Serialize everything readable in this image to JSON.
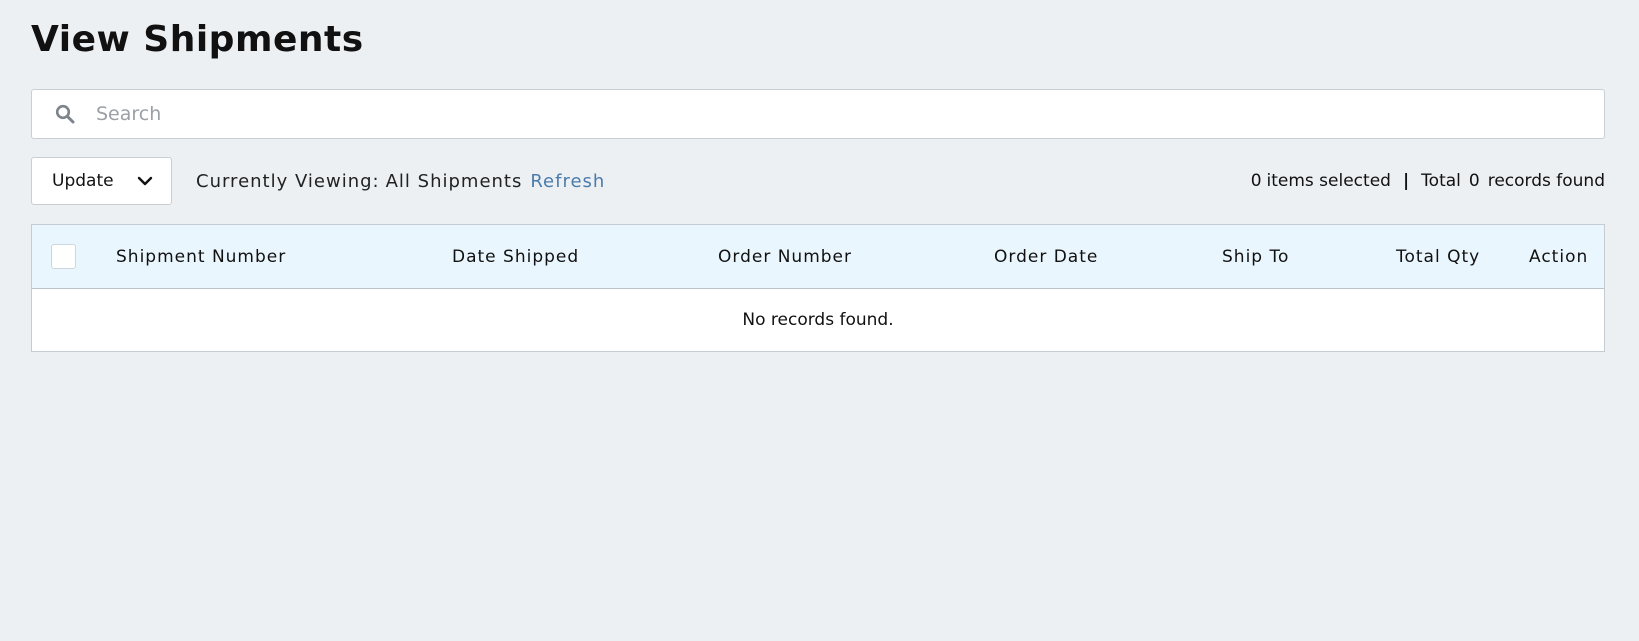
{
  "header": {
    "title": "View Shipments"
  },
  "search": {
    "placeholder": "Search",
    "value": ""
  },
  "toolbar": {
    "update_label": "Update",
    "viewing_label": "Currently Viewing:",
    "viewing_value": "All Shipments",
    "refresh_label": "Refresh",
    "selected_count": "0",
    "selected_label": "items selected",
    "separator": "|",
    "total_label": "Total",
    "total_count": "0",
    "records_label": "records found"
  },
  "table": {
    "columns": [
      "Shipment Number",
      "Date Shipped",
      "Order Number",
      "Order Date",
      "Ship To",
      "Total Qty",
      "Action"
    ],
    "rows": [],
    "empty_message": "No records found."
  },
  "colors": {
    "background": "#edf0f3",
    "header_row": "#eaf6fd",
    "link": "#4a7bab"
  },
  "icons": {
    "search": "search-icon",
    "dropdown": "chevron-down-icon"
  }
}
